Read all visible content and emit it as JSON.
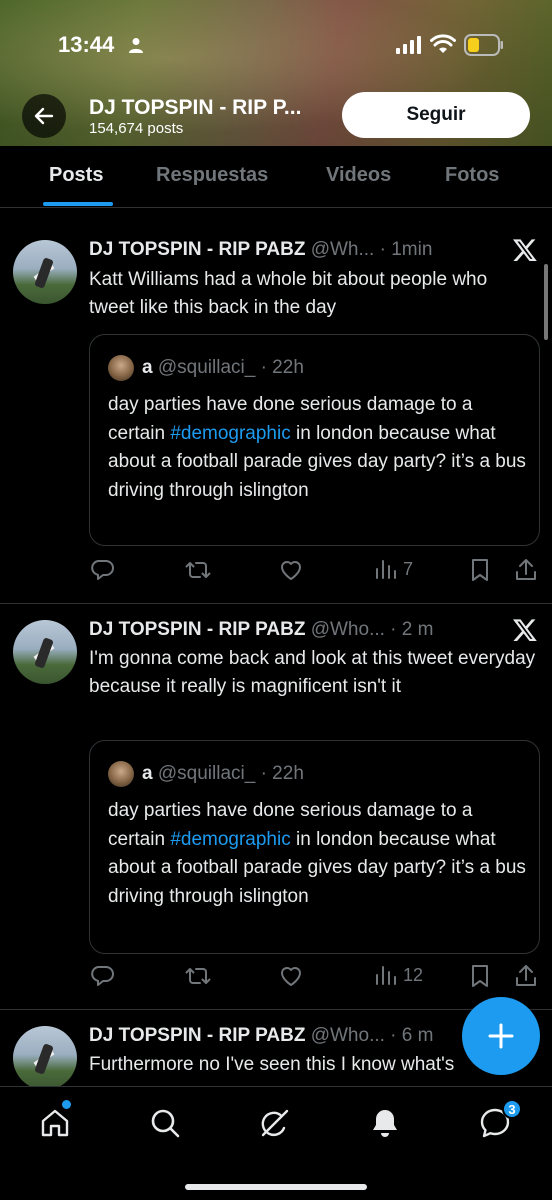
{
  "status_bar": {
    "time": "13:44"
  },
  "profile": {
    "name": "DJ TOPSPIN - RIP P...",
    "post_count": "154,674 posts",
    "follow_label": "Seguir"
  },
  "tabs": [
    {
      "label": "Posts",
      "active": true
    },
    {
      "label": "Respuestas",
      "active": false
    },
    {
      "label": "Videos",
      "active": false
    },
    {
      "label": "Fotos",
      "active": false
    }
  ],
  "tweets": [
    {
      "name": "DJ TOPSPIN - RIP PABZ",
      "handle_time": " @Wh... · 1min",
      "text": "Katt Williams had a whole bit about people who tweet like this back in the day",
      "quote": {
        "name": "a",
        "handle_time": " @squillaci_ · 22h",
        "text_before": "day parties have done serious damage to a certain ",
        "hashtag": "#demographic",
        "text_after": " in london because what about a football parade gives day party? it’s a bus driving through islington"
      },
      "views": "7"
    },
    {
      "name": "DJ TOPSPIN - RIP PABZ",
      "handle_time": " @Who... · 2 m",
      "text": "I'm gonna come back and look at this tweet everyday because it really is magnificent isn't it",
      "quote": {
        "name": "a",
        "handle_time": " @squillaci_ · 22h",
        "text_before": "day parties have done serious damage to a certain ",
        "hashtag": "#demographic",
        "text_after": " in london because what about a football parade gives day party? it’s a bus driving through islington"
      },
      "views": "12"
    },
    {
      "name": "DJ TOPSPIN - RIP PABZ",
      "handle_time": " @Who... · 6 m",
      "text": "Furthermore no I've seen this I know what's"
    }
  ],
  "bottom_nav": {
    "items": [
      "home-icon",
      "search-icon",
      "grok-icon",
      "notifications-icon",
      "messages-icon"
    ],
    "messages_badge": "3"
  },
  "colors": {
    "accent": "#1d9bf0",
    "background": "#000000",
    "text": "#e7e9ea",
    "muted": "#71767b",
    "divider": "#2f3336"
  }
}
